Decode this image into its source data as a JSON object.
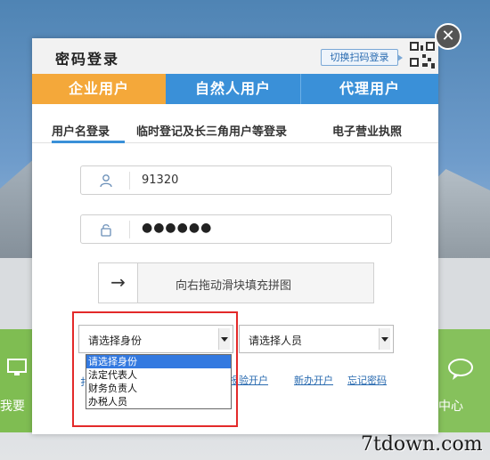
{
  "modal": {
    "title": "密码登录",
    "qr_switch_label": "切换扫码登录",
    "close_glyph": "✕"
  },
  "tabs": [
    {
      "label": "企业用户",
      "active": true
    },
    {
      "label": "自然人用户",
      "active": false
    },
    {
      "label": "代理用户",
      "active": false
    }
  ],
  "subtabs": [
    {
      "label": "用户名登录",
      "active": true
    },
    {
      "label": "临时登记及长三角用户等登录",
      "active": false
    },
    {
      "label": "电子营业执照",
      "active": false
    }
  ],
  "form": {
    "username_value": "91320",
    "password_mask": "●●●●●●",
    "slider_text": "向右拖动滑块填充拼图",
    "slider_handle_glyph": "→",
    "identity_select": {
      "value": "请选择身份",
      "options": [
        "请选择身份",
        "法定代表人",
        "财务负责人",
        "办税人员"
      ]
    },
    "person_select": {
      "value": "请选择人员"
    }
  },
  "links": {
    "stub": "扌",
    "register": "报验开户",
    "new_account": "新办开户",
    "forgot_password": "忘记密码"
  },
  "background": {
    "left_text": "我要",
    "right_text": "中心"
  },
  "watermark": "7tdown.com",
  "colors": {
    "tab_active": "#f4a83a",
    "tab_inactive": "#3a90d8",
    "highlight_box": "#e32a2a",
    "option_selected": "#3379e0"
  }
}
